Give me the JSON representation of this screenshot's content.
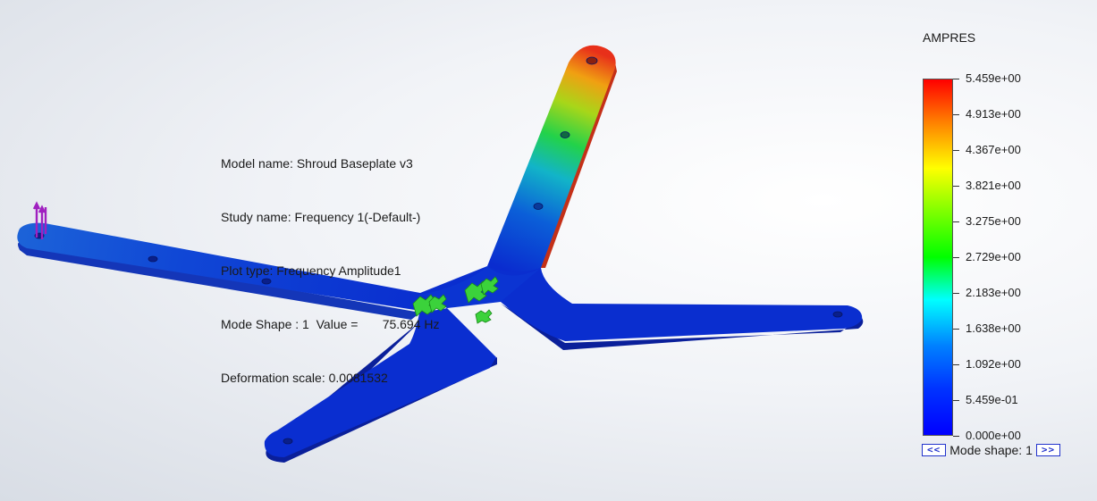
{
  "info": {
    "model_name": "Model name: Shroud Baseplate v3",
    "study_name": "Study name: Frequency 1(-Default-)",
    "plot_type": "Plot type: Frequency Amplitude1",
    "mode_shape": "Mode Shape : 1  Value =       75.694 Hz",
    "deformation_scale": "Deformation scale: 0.0081532"
  },
  "legend": {
    "title": "AMPRES",
    "labels": [
      "5.459e+00",
      "4.913e+00",
      "4.367e+00",
      "3.821e+00",
      "3.275e+00",
      "2.729e+00",
      "2.183e+00",
      "1.638e+00",
      "1.092e+00",
      "5.459e-01",
      "0.000e+00"
    ],
    "colors": [
      "#ff0000",
      "#ff8000",
      "#ffff00",
      "#80ff00",
      "#00ff00",
      "#00ffff",
      "#0080ff",
      "#0033ff",
      "#0000ff"
    ]
  },
  "mode_nav": {
    "prev_label": "<<",
    "label": "Mode shape: 1",
    "next_label": ">>"
  },
  "icons": {
    "fixture": "fixture-icon",
    "load": "load-arrow-icon",
    "mesh": "colored-part-icon"
  }
}
